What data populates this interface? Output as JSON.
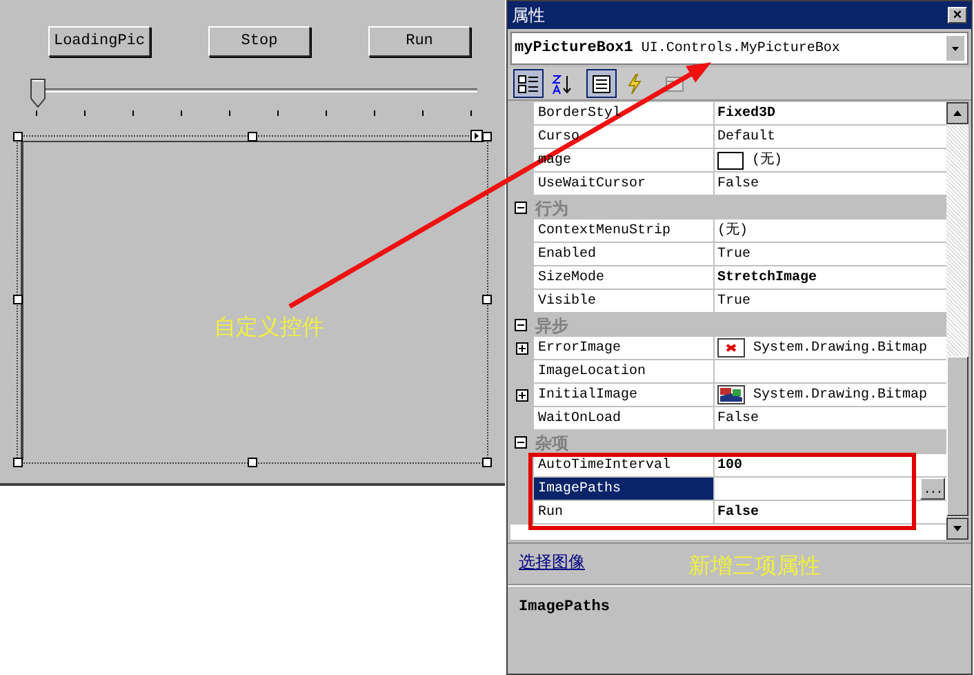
{
  "designer": {
    "buttons": [
      "LoadingPic",
      "Stop",
      "Run"
    ],
    "slider": {
      "level": 0
    },
    "annotation": "自定义控件"
  },
  "properties": {
    "title": "属性",
    "close": "×",
    "object_name": "myPictureBox1",
    "object_type": "UI.Controls.MyPictureBox",
    "toolbar": [
      {
        "kind": "categorized",
        "selected": true
      },
      {
        "kind": "alphabetical",
        "selected": false
      },
      {
        "kind": "properties",
        "selected": true
      },
      {
        "kind": "events",
        "selected": false
      },
      {
        "kind": "pages",
        "selected": false
      }
    ],
    "groups": [
      {
        "children": [
          {
            "kind": "text",
            "name": "BorderStyl",
            "value": "Fixed3D",
            "bold": true,
            "expandable": false,
            "selected": false
          },
          {
            "kind": "text",
            "name": "Curso",
            "value": "Default",
            "bold": false,
            "expandable": false,
            "selected": false
          },
          {
            "kind": "image",
            "name": "mage",
            "value": "(无)",
            "bold": false,
            "expandable": false,
            "selected": false
          },
          {
            "kind": "text",
            "name": "UseWaitCursor",
            "value": "False",
            "bold": false,
            "expandable": false,
            "selected": false
          }
        ]
      },
      {
        "name": "行为",
        "children": [
          {
            "kind": "text",
            "name": "ContextMenuStrip",
            "value": "(无)",
            "bold": false,
            "expandable": false,
            "selected": false
          },
          {
            "kind": "text",
            "name": "Enabled",
            "value": "True",
            "bold": false,
            "expandable": false,
            "selected": false
          },
          {
            "kind": "text",
            "name": "SizeMode",
            "value": "StretchImage",
            "bold": true,
            "expandable": false,
            "selected": false
          },
          {
            "kind": "text",
            "name": "Visible",
            "value": "True",
            "bold": false,
            "expandable": false,
            "selected": false
          }
        ]
      },
      {
        "name": "异步",
        "children": [
          {
            "kind": "error-image",
            "name": "ErrorImage",
            "value": "System.Drawing.Bitmap",
            "bold": false,
            "expandable": true,
            "selected": false
          },
          {
            "kind": "text",
            "name": "ImageLocation",
            "expandable": false,
            "selected": false
          },
          {
            "kind": "bitmap-image",
            "name": "InitialImage",
            "value": "System.Drawing.Bitmap",
            "bold": false,
            "expandable": true,
            "selected": false
          },
          {
            "kind": "text",
            "name": "WaitOnLoad",
            "value": "False",
            "bold": false,
            "expandable": false,
            "selected": false
          }
        ]
      },
      {
        "name": "杂项",
        "children": [
          {
            "kind": "text",
            "name": "AutoTimeInterval",
            "value": "100",
            "bold": true,
            "expandable": false,
            "selected": false
          },
          {
            "kind": "text",
            "name": "ImagePaths",
            "expandable": false,
            "selected": true,
            "ellipsis": "..."
          },
          {
            "kind": "text",
            "name": "Run",
            "value": "False",
            "bold": true,
            "expandable": false,
            "selected": false
          }
        ]
      }
    ],
    "description": {
      "link": "选择图像",
      "name": "ImagePaths"
    },
    "annotation": "新增三项属性"
  }
}
